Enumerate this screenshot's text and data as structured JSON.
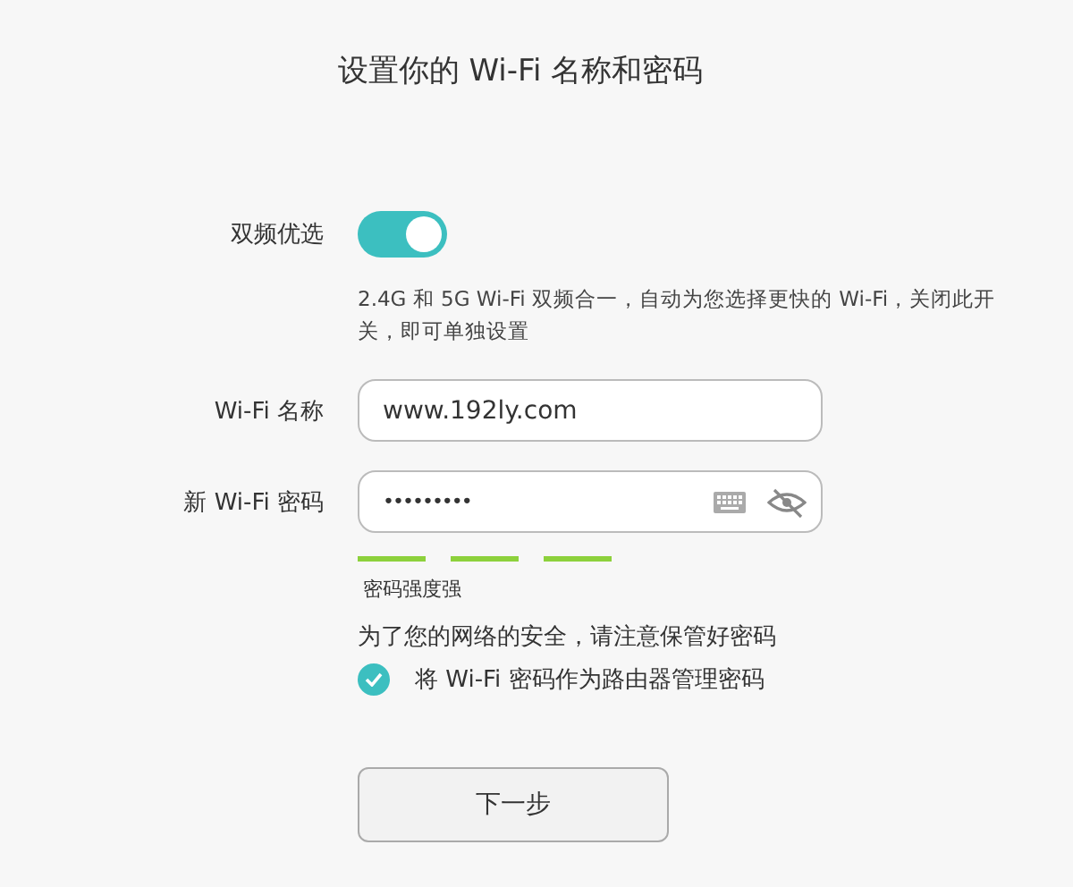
{
  "title": "设置你的 Wi-Fi 名称和密码",
  "dual_band": {
    "label": "双频优选",
    "on": true,
    "description": "2.4G 和 5G Wi-Fi 双频合一，自动为您选择更快的 Wi-Fi，关闭此开关，即可单独设置"
  },
  "wifi_name": {
    "label": "Wi-Fi 名称",
    "value": "www.192ly.com"
  },
  "wifi_password": {
    "label": "新 Wi-Fi 密码",
    "value": "•••••••••"
  },
  "strength": {
    "bars": [
      {
        "lit": true
      },
      {
        "lit": true
      },
      {
        "lit": true
      }
    ],
    "label": "密码强度强"
  },
  "security_note": "为了您的网络的安全，请注意保管好密码",
  "use_as_admin": {
    "label": "将 Wi-Fi 密码作为路由器管理密码",
    "checked": true
  },
  "next_button": "下一步"
}
